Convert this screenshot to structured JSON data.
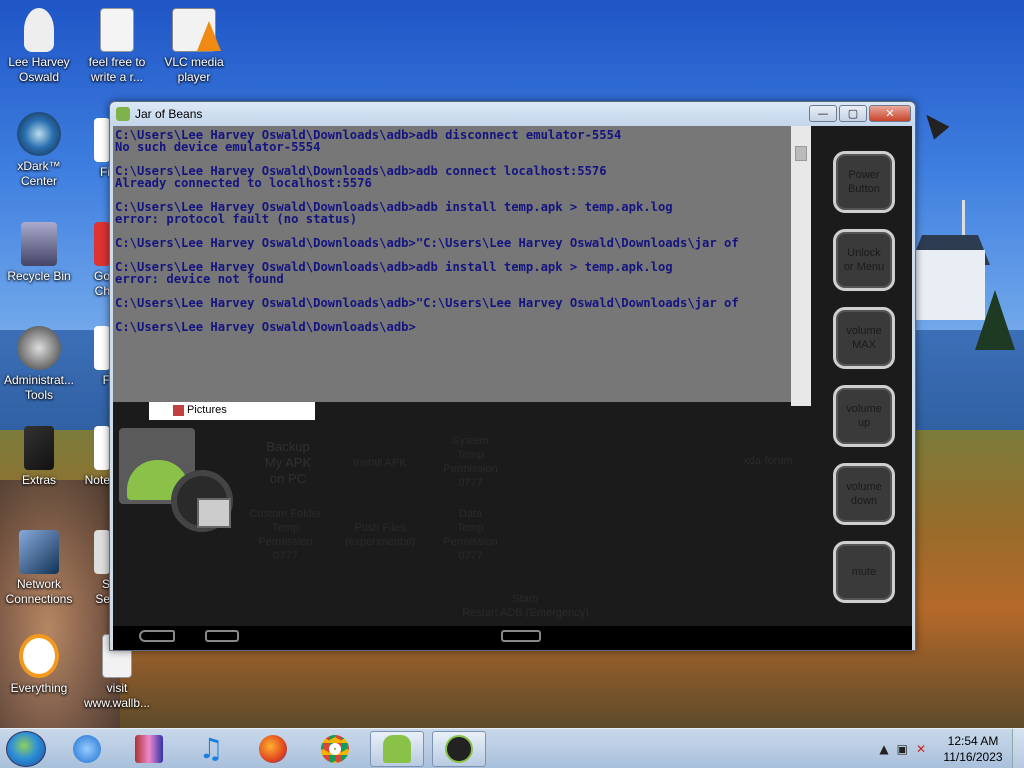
{
  "desktop": {
    "icons": [
      {
        "label": "Lee Harvey\nOswald",
        "icon": "user-folder-icon"
      },
      {
        "label": "feel free to\nwrite a r...",
        "icon": "text-document-icon"
      },
      {
        "label": "VLC media\nplayer",
        "icon": "vlc-icon"
      },
      {
        "label": "xDark™\nCenter",
        "icon": "xdark-center-icon"
      },
      {
        "label": "Fi",
        "icon": "file-icon"
      },
      {
        "label": "Recycle Bin",
        "icon": "recycle-bin-icon"
      },
      {
        "label": "Go\nCh",
        "icon": "chrome-shortcut-icon"
      },
      {
        "label": "Administrat...\nTools",
        "icon": "admin-tools-icon"
      },
      {
        "label": "F",
        "icon": "file-icon"
      },
      {
        "label": "Extras",
        "icon": "extras-folder-icon"
      },
      {
        "label": "Note",
        "icon": "notepad-icon"
      },
      {
        "label": "Network\nConnections",
        "icon": "network-connections-icon"
      },
      {
        "label": "S\nSe",
        "icon": "settings-icon"
      },
      {
        "label": "Everything",
        "icon": "everything-search-icon"
      },
      {
        "label": "visit\nwww.wallb...",
        "icon": "text-document-icon"
      }
    ]
  },
  "window": {
    "title": "Jar of Beans",
    "minimize": "—",
    "maximize": "▢",
    "close": "✕"
  },
  "console": {
    "lines": [
      "C:\\Users\\Lee Harvey Oswald\\Downloads\\adb>adb disconnect emulator-5554",
      "No such device emulator-5554",
      "",
      "C:\\Users\\Lee Harvey Oswald\\Downloads\\adb>adb connect localhost:5576",
      "Already connected to localhost:5576",
      "",
      "C:\\Users\\Lee Harvey Oswald\\Downloads\\adb>adb install temp.apk > temp.apk.log",
      "error: protocol fault (no status)",
      "",
      "C:\\Users\\Lee Harvey Oswald\\Downloads\\adb>\"C:\\Users\\Lee Harvey Oswald\\Downloads\\jar of",
      "",
      "C:\\Users\\Lee Harvey Oswald\\Downloads\\adb>adb install temp.apk > temp.apk.log",
      "error: device not found",
      "",
      "C:\\Users\\Lee Harvey Oswald\\Downloads\\adb>\"C:\\Users\\Lee Harvey Oswald\\Downloads\\jar of",
      "",
      "C:\\Users\\Lee Harvey Oswald\\Downloads\\adb>"
    ],
    "explorer_item": "Pictures"
  },
  "side_buttons": [
    "Power\nButton",
    "Unlock\nor Menu",
    "volume\nMAX",
    "volume\nup",
    "volume\ndown",
    "mute"
  ],
  "app_actions": {
    "backup": "Backup\nMy APK\non PC",
    "install_apk": "Install APK",
    "system_temp": "System\nTemp\nPermission\n0777",
    "xda": "xda-forum",
    "custom_folder": "Custom Folder\nTemp\nPermission\n0777",
    "push_files": "Push Files\n(experimental)",
    "data_temp": "Data\nTemp\nPermission\n0777",
    "restart_adb": "Start/\nRestart ADB (Emergency)"
  },
  "taskbar": {
    "items": [
      "internet-explorer-icon",
      "winrar-icon",
      "itunes-icon",
      "firefox-icon",
      "chrome-icon",
      "jar-of-beans-icon",
      "android-terminal-icon"
    ],
    "time": "12:54 AM",
    "date": "11/16/2023"
  }
}
